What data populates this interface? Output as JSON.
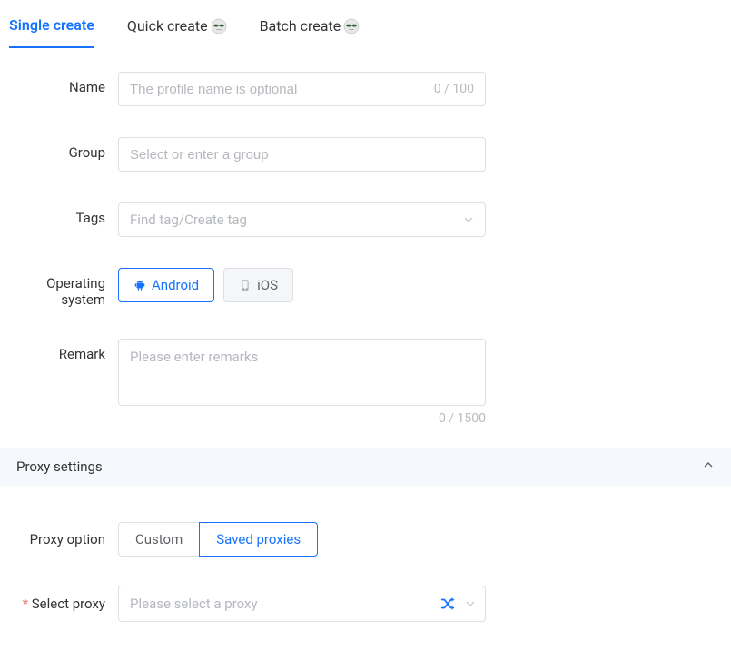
{
  "tabs": {
    "single_create": "Single create",
    "quick_create": "Quick create",
    "batch_create": "Batch create"
  },
  "form": {
    "name": {
      "label": "Name",
      "placeholder": "The profile name is optional",
      "value": "",
      "counter": "0 / 100"
    },
    "group": {
      "label": "Group",
      "placeholder": "Select or enter a group",
      "value": ""
    },
    "tags": {
      "label": "Tags",
      "placeholder": "Find tag/Create tag"
    },
    "os": {
      "label": "Operating system",
      "android": "Android",
      "ios": "iOS"
    },
    "remark": {
      "label": "Remark",
      "placeholder": "Please enter remarks",
      "value": "",
      "counter": "0 / 1500"
    }
  },
  "proxy": {
    "header": "Proxy settings",
    "option_label": "Proxy option",
    "custom": "Custom",
    "saved": "Saved proxies",
    "select_label": "Select proxy",
    "select_placeholder": "Please select a proxy"
  }
}
